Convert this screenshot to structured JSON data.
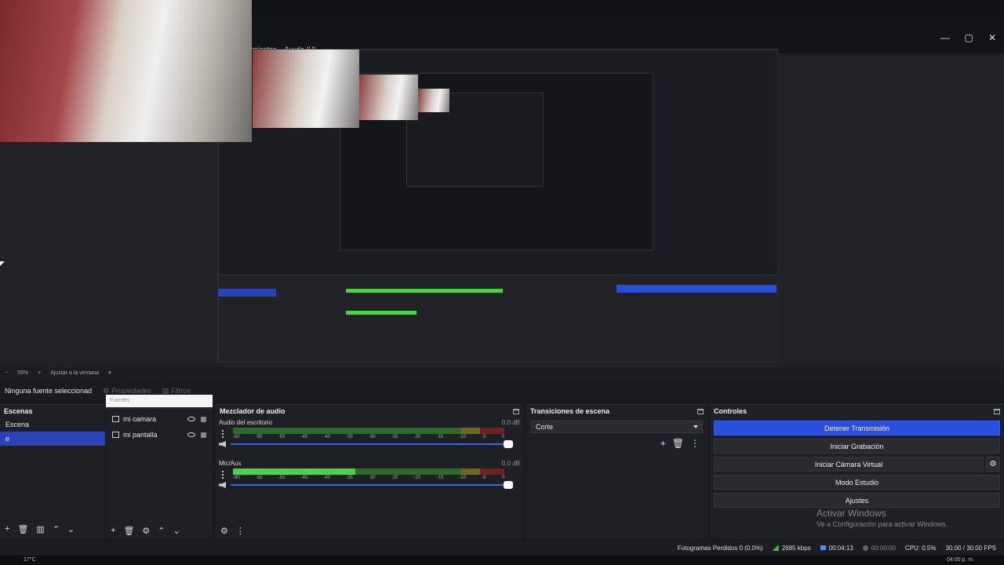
{
  "window": {
    "controls": {
      "minimize": "—",
      "maximize": "▢",
      "close": "✕"
    }
  },
  "menubar": {
    "items": [
      "mientas",
      "Ayuda (H)"
    ]
  },
  "zoom": {
    "value": "55%",
    "fit_label": "Ajustar a la ventana",
    "minus": "−",
    "plus": "+"
  },
  "source_toolbar": {
    "no_source": "Ninguna fuente seleccionad",
    "properties": "Propiedades",
    "filters": "Filtros"
  },
  "scenes": {
    "title": "Escenas",
    "items": [
      {
        "label": "Escena",
        "selected": false
      },
      {
        "label": "e",
        "selected": true
      }
    ]
  },
  "sources": {
    "header": "Fuentes",
    "items": [
      {
        "label": "mi camara",
        "icon": "camera-icon"
      },
      {
        "label": "mi pantalla",
        "icon": "monitor-icon"
      }
    ]
  },
  "mixer": {
    "title": "Mezclador de audio",
    "ticks": [
      "-60",
      "-55",
      "-50",
      "-45",
      "-40",
      "-35",
      "-30",
      "-25",
      "-20",
      "-15",
      "-10",
      "-5",
      "0"
    ],
    "channels": [
      {
        "name": "Audio del escritorio",
        "db": "0.0 dB",
        "level": 0.0
      },
      {
        "name": "Mic/Aux",
        "db": "0.0 dB",
        "level": 0.45
      }
    ]
  },
  "transitions": {
    "title": "Transiciones de escena",
    "selected": "Corte"
  },
  "controls": {
    "title": "Controles",
    "stop_streaming": "Detener Transmisión",
    "start_recording": "Iniciar Grabación",
    "start_virtual_cam": "Iniciar Cámara Virtual",
    "studio_mode": "Modo Estudio",
    "settings": "Ajustes"
  },
  "watermark": {
    "line1": "Activar Windows",
    "line2": "Ve a Configuración para activar Windows."
  },
  "status": {
    "dropped_frames": "Fotogramas Perdidos 0 (0.0%)",
    "bitrate": "2685 kbps",
    "stream_time": "00:04:13",
    "rec_time": "00:00:00",
    "cpu": "CPU: 0.5%",
    "fps": "30.00 / 30.00 FPS"
  },
  "taskbar": {
    "temp": "17°C",
    "clock": "04:00 p. m."
  },
  "colors": {
    "accent": "#2a4fdc",
    "selected": "#2c43b8",
    "meter_green": "#4bd24b"
  }
}
